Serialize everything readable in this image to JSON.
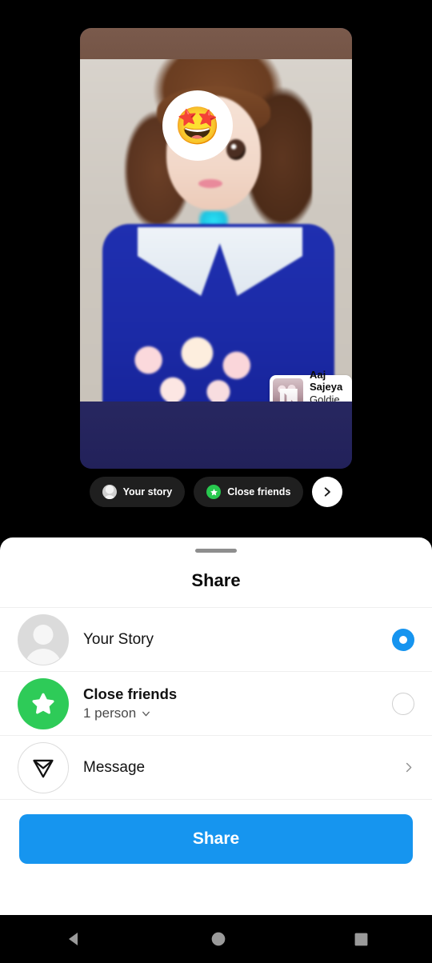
{
  "composer": {
    "story_card": {
      "emoji_sticker": "🤩",
      "music_sticker": {
        "title": "Aaj Sajeya",
        "artist": "Goldie Sohel"
      }
    },
    "chips": [
      {
        "label": "Your story",
        "icon": "avatar-icon"
      },
      {
        "label": "Close friends",
        "icon": "green-star-icon"
      }
    ],
    "next_button": {
      "icon": "chevron-right-icon"
    }
  },
  "sheet": {
    "title": "Share",
    "rows": [
      {
        "label": "Your Story",
        "sub": "",
        "icon": "default-avatar-icon",
        "control": "radio-selected"
      },
      {
        "label": "Close friends",
        "sub": "1 person",
        "icon": "green-star-icon",
        "control": "radio-unselected"
      },
      {
        "label": "Message",
        "sub": "",
        "icon": "send-paper-plane-icon",
        "control": "chevron-right"
      }
    ],
    "share_button": "Share"
  },
  "navbar": {
    "back": "back-triangle-icon",
    "home": "home-circle-icon",
    "recents": "recents-square-icon"
  },
  "colors": {
    "accent_blue": "#1695ef",
    "close_friends_green": "#2ecb58",
    "sheet_bg": "#ffffff",
    "app_bg": "#000000"
  }
}
